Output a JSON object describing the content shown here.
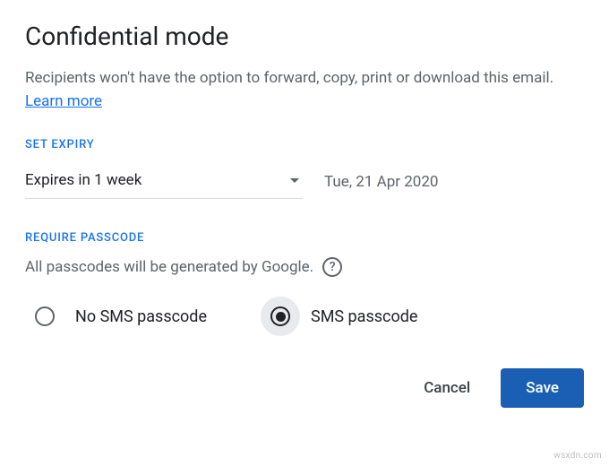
{
  "dialog": {
    "title": "Confidential mode",
    "description": "Recipients won't have the option to forward, copy, print or download this email. ",
    "learn_more": "Learn more"
  },
  "expiry": {
    "section_label": "SET EXPIRY",
    "selected": "Expires in 1 week",
    "date": "Tue, 21 Apr 2020"
  },
  "passcode": {
    "section_label": "REQUIRE PASSCODE",
    "description": "All passcodes will be generated by Google.",
    "help_glyph": "?",
    "options": [
      {
        "label": "No SMS passcode",
        "selected": false
      },
      {
        "label": "SMS passcode",
        "selected": true
      }
    ]
  },
  "buttons": {
    "cancel": "Cancel",
    "save": "Save"
  },
  "watermark": "wsxdn.com"
}
